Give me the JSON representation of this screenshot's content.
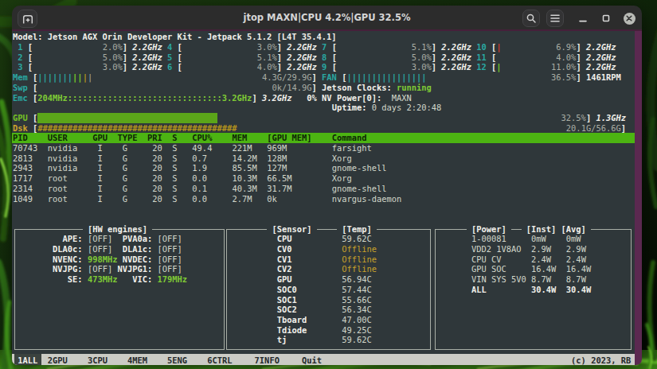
{
  "window": {
    "title": "jtop MAXN|CPU 4.2%|GPU 32.5%"
  },
  "model_line": "Model: Jetson AGX Orin Developer Kit - Jetpack 5.1.2 [L4T 35.4.1]",
  "cpus": [
    {
      "id": "1",
      "pct": "2.0%",
      "freq": "2.2GHz"
    },
    {
      "id": "2",
      "pct": "5.0%",
      "freq": "2.2GHz"
    },
    {
      "id": "3",
      "pct": "3.0%",
      "freq": "2.2GHz"
    },
    {
      "id": "4",
      "pct": "3.0%",
      "freq": "2.2GHz"
    },
    {
      "id": "5",
      "pct": "5.1%",
      "freq": "2.2GHz"
    },
    {
      "id": "6",
      "pct": "4.0%",
      "freq": "2.2GHz"
    },
    {
      "id": "7",
      "pct": "5.1%",
      "freq": "2.2GHz"
    },
    {
      "id": "8",
      "pct": "5.0%",
      "freq": "2.2GHz"
    },
    {
      "id": "9",
      "pct": "3.0%",
      "freq": "2.2GHz"
    },
    {
      "id": "10",
      "pct": "6.9%",
      "freq": "2.2GHz",
      "mark": "red"
    },
    {
      "id": "11",
      "pct": "4.0%",
      "freq": "2.2GHz"
    },
    {
      "id": "12",
      "pct": "11.0%",
      "freq": "2.2GHz",
      "mark": "green"
    }
  ],
  "memory": {
    "label": "Mem",
    "value": "4.3G/29.9G",
    "pipes": [
      [
        "cyan",
        7
      ],
      [
        "green",
        2
      ],
      [
        "yellow",
        1
      ],
      [
        "gray",
        1
      ]
    ]
  },
  "swap": {
    "label": "Swp",
    "value": "0k/14.9G"
  },
  "emc": {
    "label": "Emc",
    "bar": "204MHz:::::::::::::::::::::::::::::::3.2GHz",
    "freq": "3.2GHz",
    "pct": "0%"
  },
  "fan": {
    "label": "FAN",
    "value": "36.5%",
    "rpm": "1461RPM",
    "pipes": [
      [
        "cyan",
        16
      ]
    ]
  },
  "jetson_clocks": {
    "label": "Jetson Clocks:",
    "value": "running"
  },
  "nv_power": {
    "label": "NV Power[0]:",
    "value": "MAXN"
  },
  "uptime": {
    "label": "Uptime:",
    "value": "0 days 2:20:48"
  },
  "gpu": {
    "label": "GPU",
    "pct": "32.5%",
    "freq": "1.3GHz",
    "fill_cells": 36
  },
  "disk": {
    "label": "Dsk",
    "value": "20.1G/56.6G",
    "hash_cells": 40
  },
  "processes": {
    "headers": [
      "PID",
      "USER",
      "GPU",
      "TYPE",
      "PRI",
      "S",
      "CPU%",
      "MEM",
      "[GPU MEM]",
      "Command"
    ],
    "rows": [
      [
        "70743",
        "nvidia",
        "I",
        "G",
        "20",
        "S",
        "49.4",
        "221M",
        "969M",
        "farsight"
      ],
      [
        "2813",
        "nvidia",
        "I",
        "G",
        "20",
        "S",
        "0.7",
        "14.2M",
        "128M",
        "Xorg"
      ],
      [
        "2943",
        "nvidia",
        "I",
        "G",
        "20",
        "S",
        "1.9",
        "85.5M",
        "127M",
        "gnome-shell"
      ],
      [
        "1717",
        "root",
        "I",
        "G",
        "20",
        "S",
        "0.0",
        "10.3M",
        "66.5M",
        "Xorg"
      ],
      [
        "2314",
        "root",
        "I",
        "G",
        "20",
        "S",
        "0.1",
        "40.3M",
        "31.7M",
        "gnome-shell"
      ],
      [
        "1049",
        "root",
        "I",
        "G",
        "20",
        "S",
        "0.0",
        "2.7M",
        "0k",
        "nvargus-daemon"
      ]
    ]
  },
  "hw_engines": {
    "title": "[HW engines]",
    "rows": [
      [
        {
          "k": "APE:",
          "v": "[OFF]"
        },
        {
          "k": "PVA0a:",
          "v": "[OFF]"
        }
      ],
      [
        {
          "k": "DLA0c:",
          "v": "[OFF]"
        },
        {
          "k": "DLA1c:",
          "v": "[OFF]"
        }
      ],
      [
        {
          "k": "NVENC:",
          "v": "998MHz",
          "on": true
        },
        {
          "k": "NVDEC:",
          "v": "[OFF]"
        }
      ],
      [
        {
          "k": "NVJPG:",
          "v": "[OFF]"
        },
        {
          "k": "NVJPG1:",
          "v": "[OFF]"
        }
      ],
      [
        {
          "k": "SE:",
          "v": "473MHz",
          "on": true
        },
        {
          "k": "VIC:",
          "v": "179MHz",
          "on": true
        }
      ]
    ]
  },
  "sensors": {
    "title_left": "[Sensor]",
    "title_right": "[Temp]",
    "rows": [
      {
        "name": "CPU",
        "value": "59.62C"
      },
      {
        "name": "CV0",
        "value": "Offline",
        "off": true
      },
      {
        "name": "CV1",
        "value": "Offline",
        "off": true
      },
      {
        "name": "CV2",
        "value": "Offline",
        "off": true
      },
      {
        "name": "GPU",
        "value": "56.94C"
      },
      {
        "name": "SOC0",
        "value": "57.44C"
      },
      {
        "name": "SOC1",
        "value": "55.66C"
      },
      {
        "name": "SOC2",
        "value": "56.34C"
      },
      {
        "name": "Tboard",
        "value": "47.00C"
      },
      {
        "name": "Tdiode",
        "value": "49.25C"
      },
      {
        "name": "tj",
        "value": "59.62C"
      }
    ]
  },
  "power": {
    "title": "[Power]",
    "col_inst": "[Inst]",
    "col_avg": "[Avg]",
    "rows": [
      {
        "name": "1-00081",
        "inst": "0mW",
        "avg": "0mW"
      },
      {
        "name": "VDD2 1V8AO",
        "inst": "2.9W",
        "avg": "2.9W"
      },
      {
        "name": "CPU CV",
        "inst": "2.4W",
        "avg": "2.4W"
      },
      {
        "name": "GPU SOC",
        "inst": "16.4W",
        "avg": "16.4W"
      },
      {
        "name": "VIN SYS 5V0",
        "inst": "8.7W",
        "avg": "8.7W"
      },
      {
        "name": "ALL",
        "inst": "30.4W",
        "avg": "30.4W",
        "bold": true
      }
    ]
  },
  "menu": {
    "items": [
      {
        "label": "1ALL",
        "active": true
      },
      {
        "label": "2GPU"
      },
      {
        "label": "3CPU"
      },
      {
        "label": "4MEM"
      },
      {
        "label": "5ENG"
      },
      {
        "label": "6CTRL"
      },
      {
        "label": "7INFO"
      },
      {
        "label": "Quit"
      }
    ],
    "copyright": "(c) 2023, RB"
  },
  "colors": {
    "terminal_bg": "#2f373a",
    "titlebar_bg": "#2c2c2c",
    "scrollbar": "#5b2950",
    "header_band": "#4cb412",
    "gpu_fill": "#5ba519",
    "statusbar_bg": "#cbcbc5",
    "teal": "#2aa8a2",
    "green": "#7fcb35",
    "yellow": "#c9a22b",
    "red": "#d93a2b"
  }
}
